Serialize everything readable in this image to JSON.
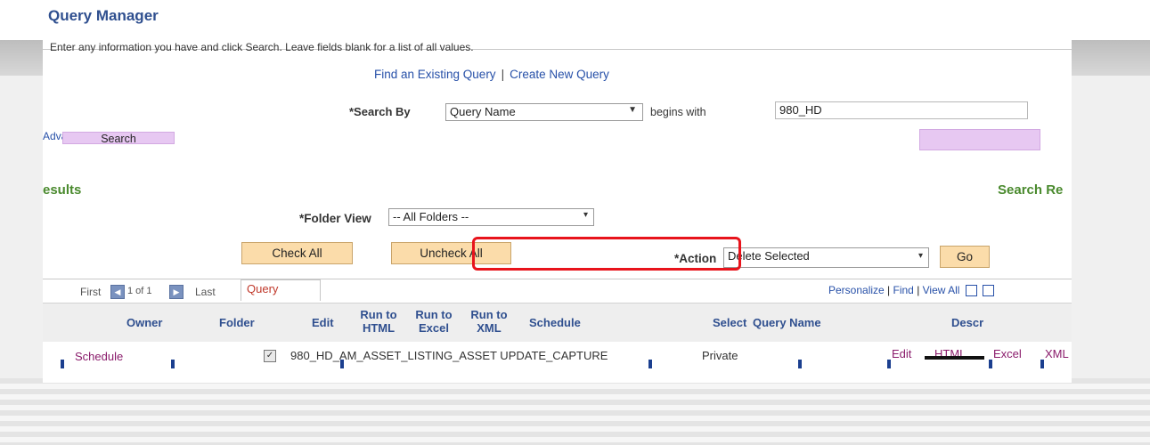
{
  "title": "Query Manager",
  "instructions": "Enter any information you have and click Search. Leave fields blank for a list of all values.",
  "tabs": {
    "find": "Find an Existing Query",
    "create": "Create New Query"
  },
  "search": {
    "by_label": "*Search By",
    "by_value": "Query Name",
    "begins_label": "begins with",
    "begins_value": "980_HD",
    "advanced_link": "Advanced Search",
    "button": "Search"
  },
  "results": {
    "heading_left": "esults",
    "heading_right": "Search Re"
  },
  "folder_view": {
    "label": "*Folder View",
    "value": "-- All Folders --"
  },
  "buttons": {
    "check_all": "Check All",
    "uncheck_all": "Uncheck All",
    "go": "Go"
  },
  "action": {
    "label": "*Action",
    "value": "Delete Selected"
  },
  "grid": {
    "first": "First",
    "count": "1 of 1",
    "last": "Last",
    "tab": "Query",
    "personalize": "Personalize",
    "find": "Find",
    "view_all": "View All",
    "headers": {
      "owner": "Owner",
      "folder": "Folder",
      "edit": "Edit",
      "run_html": "Run to HTML",
      "run_excel": "Run to Excel",
      "run_xml": "Run to XML",
      "schedule": "Schedule",
      "select": "Select",
      "query_name": "Query Name",
      "descr": "Descr"
    },
    "row": {
      "schedule": "Schedule",
      "checked": "✓",
      "query_name": "980_HD_AM_ASSET_LISTING_ASSET UPDATE_CAPTURE",
      "owner": "Private",
      "edit": "Edit",
      "html": "HTML",
      "excel": "Excel",
      "xml": "XML"
    }
  },
  "colors": {
    "title": "#2f4f8f",
    "link": "#2750a8",
    "results": "#4a8a2e",
    "highlight": "#e8141c",
    "button": "#fbdcaa"
  }
}
